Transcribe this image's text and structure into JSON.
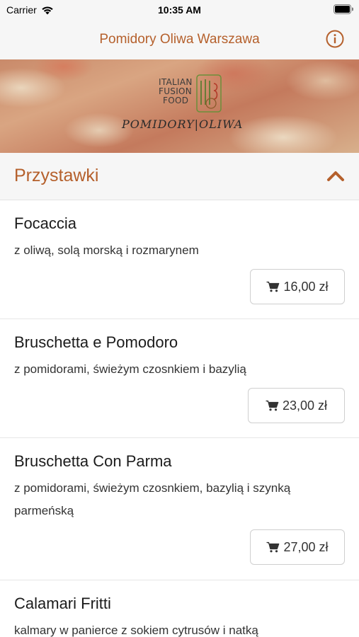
{
  "status_bar": {
    "carrier": "Carrier",
    "time": "10:35 AM"
  },
  "nav": {
    "title": "Pomidory Oliwa Warszawa",
    "info_icon": "info-circle-icon"
  },
  "banner": {
    "logo_line1": "ITALIAN",
    "logo_line2": "FUSION",
    "logo_line3": "FOOD",
    "logo_brand": "POMIDORY|OLIWA"
  },
  "section": {
    "title": "Przystawki",
    "icon": "chevron-up-icon"
  },
  "menu": {
    "items": [
      {
        "name": "Focaccia",
        "description": "z oliwą, solą morską i rozmarynem",
        "price": "16,00 zł"
      },
      {
        "name": "Bruschetta e Pomodoro",
        "description": "z pomidorami, świeżym czosnkiem i bazylią",
        "price": "23,00 zł"
      },
      {
        "name": "Bruschetta Con Parma",
        "description": "z pomidorami, świeżym czosnkiem, bazylią i szynką parmeńską",
        "price": "27,00 zł"
      },
      {
        "name": "Calamari Fritti",
        "description": "kalmary w panierce z sokiem cytrusów i natką",
        "price": ""
      }
    ]
  },
  "colors": {
    "accent": "#b5602c",
    "background": "#ffffff",
    "header_background": "#f6f6f6"
  }
}
